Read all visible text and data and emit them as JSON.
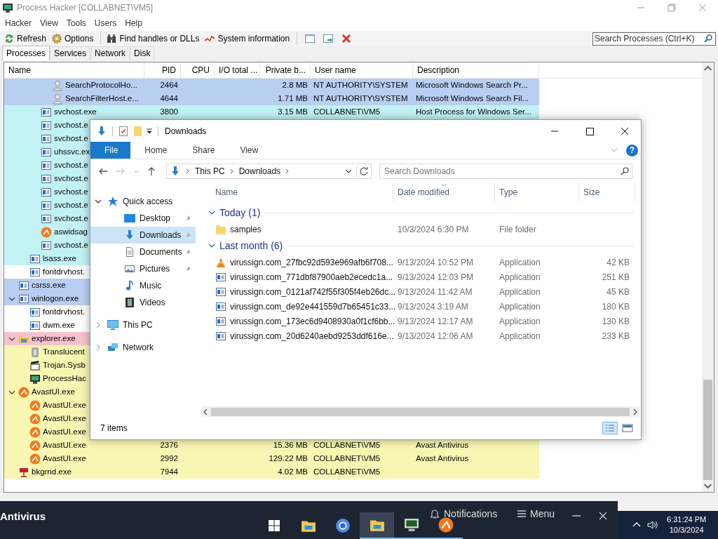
{
  "process_hacker": {
    "title": "Process Hacker [COLLABNET\\VM5]",
    "menu": [
      "Hacker",
      "View",
      "Tools",
      "Users",
      "Help"
    ],
    "toolbar": [
      {
        "label": "Refresh",
        "kind": "refresh"
      },
      {
        "label": "Options",
        "kind": "options"
      },
      {
        "label": "Find handles or DLLs",
        "kind": "find"
      },
      {
        "label": "System information",
        "kind": "sysinfo"
      }
    ],
    "search": {
      "placeholder": "Search Processes (Ctrl+K)"
    },
    "tabs": [
      {
        "label": "Processes",
        "selected": true
      },
      {
        "label": "Services",
        "selected": false
      },
      {
        "label": "Network",
        "selected": false
      },
      {
        "label": "Disk",
        "selected": false
      }
    ],
    "columns": [
      "Name",
      "PID",
      "CPU",
      "I/O total ...",
      "Private b...",
      "User name",
      "Description"
    ],
    "processes": [
      {
        "children": [
          {
            "children": [
              {
                "children": [
                  {
                    "name": "SearchProtocolHo...",
                    "pid": "2464",
                    "private": "2.8 MB",
                    "user": "NT AUTHORITY\\SYSTEM",
                    "description": "Microsoft Windows Search Pr...",
                    "kind": "person",
                    "color": "#b9cff2"
                  },
                  {
                    "name": "SearchFilterHost.e...",
                    "pid": "4644",
                    "private": "1.71 MB",
                    "user": "NT AUTHORITY\\SYSTEM",
                    "description": "Microsoft Windows Search Fil...",
                    "kind": "person",
                    "color": "#b9cff2"
                  }
                ]
              },
              {
                "name": "svchost.exe",
                "pid": "3800",
                "private": "3.15 MB",
                "user": "COLLABNET\\VM5",
                "description": "Host Process for Windows Ser...",
                "kind": "app",
                "color": "#c3f2f5"
              },
              {
                "name": "svchost.e",
                "kind": "app",
                "color": "#c3f2f5"
              },
              {
                "name": "svchost.e",
                "kind": "app",
                "color": "#c3f2f5"
              },
              {
                "name": "uhssvc.ex",
                "kind": "app",
                "color": "#c3f2f5"
              },
              {
                "name": "svchost.e",
                "kind": "app",
                "color": "#c3f2f5"
              },
              {
                "name": "svchost.e",
                "kind": "app",
                "color": "#c3f2f5"
              },
              {
                "name": "svchost.e",
                "kind": "app",
                "color": "#c3f2f5"
              },
              {
                "name": "svchost.e",
                "kind": "app",
                "color": "#c3f2f5"
              },
              {
                "name": "svchost.e",
                "kind": "app",
                "color": "#c3f2f5"
              },
              {
                "name": "aswidsag",
                "kind": "orange",
                "color": "#c3f2f5"
              },
              {
                "name": "svchost.e",
                "kind": "app",
                "color": "#c3f2f5"
              }
            ]
          },
          {
            "name": "lsass.exe",
            "kind": "app",
            "color": "#c3f2f5"
          },
          {
            "name": "fontdrvhost.",
            "kind": "app",
            "color": "#ffffff"
          }
        ]
      },
      {
        "name": "csrss.exe",
        "kind": "app",
        "color": "#b9cff2"
      },
      {
        "name": "winlogon.exe",
        "kind": "app",
        "color": "#b9cff2",
        "expanded": true,
        "children": [
          {
            "name": "fontdrvhost.",
            "kind": "app",
            "color": "#ffffff"
          },
          {
            "name": "dwm.exe",
            "kind": "app",
            "color": "#ffffff"
          }
        ]
      },
      {
        "name": "explorer.exe",
        "kind": "folder",
        "color": "#f6c3cd",
        "expanded": true,
        "children": [
          {
            "name": "Translucent",
            "kind": "gray",
            "color": "#f8f6b3"
          },
          {
            "name": "Trojan.Sysb",
            "kind": "clapper",
            "color": "#f8f6b3"
          },
          {
            "name": "ProcessHac",
            "kind": "monitor",
            "color": "#f8f6b3"
          }
        ]
      },
      {
        "name": "AvastUI.exe",
        "kind": "orange",
        "color": "#f8f6b3",
        "expanded": true,
        "children": [
          {
            "name": "AvastUI.exe",
            "kind": "orange",
            "color": "#f8f6b3"
          },
          {
            "name": "AvastUI.exe",
            "kind": "orange",
            "color": "#f8f6b3"
          },
          {
            "name": "AvastUI.exe",
            "kind": "orange",
            "color": "#f8f6b3"
          },
          {
            "name": "AvastUI.exe",
            "pid": "2376",
            "private": "15.36 MB",
            "user": "COLLABNET\\VM5",
            "description": "Avast Antivirus",
            "kind": "orange",
            "color": "#f8f6b3"
          },
          {
            "name": "AvastUI.exe",
            "pid": "2992",
            "private": "129.22 MB",
            "user": "COLLABNET\\VM5",
            "description": "Avast Antivirus",
            "kind": "orange",
            "color": "#f8f6b3"
          }
        ]
      },
      {
        "name": "bkgrnd.exe",
        "pid": "7944",
        "private": "4.02 MB",
        "user": "COLLABNET\\VM5",
        "kind": "red",
        "color": "#f8f6b3"
      }
    ]
  },
  "explorer": {
    "title": "Downloads",
    "ribbon_tabs": [
      {
        "label": "File",
        "selected": true
      },
      {
        "label": "Home",
        "selected": false
      },
      {
        "label": "Share",
        "selected": false
      },
      {
        "label": "View",
        "selected": false
      }
    ],
    "help": "?",
    "path": [
      "This PC",
      "Downloads"
    ],
    "search": {
      "placeholder": "Search Downloads"
    },
    "nav": [
      {
        "label": "Quick access",
        "kind": "star",
        "expanded": true,
        "selected": false,
        "children": [
          {
            "label": "Desktop",
            "kind": "desktop",
            "pinned": true,
            "selected": false
          },
          {
            "label": "Downloads",
            "kind": "download",
            "pinned": true,
            "selected": true
          },
          {
            "label": "Documents",
            "kind": "document",
            "pinned": true,
            "selected": false
          },
          {
            "label": "Pictures",
            "kind": "picture",
            "pinned": true,
            "selected": false
          },
          {
            "label": "Music",
            "kind": "music",
            "pinned": false,
            "selected": false
          },
          {
            "label": "Videos",
            "kind": "video",
            "pinned": false,
            "selected": false
          }
        ]
      },
      {
        "label": "This PC",
        "kind": "pc",
        "expanded": false,
        "selected": false
      },
      {
        "label": "Network",
        "kind": "network",
        "expanded": false,
        "selected": false
      }
    ],
    "columns": [
      "Name",
      "Date modified",
      "Type",
      "Size"
    ],
    "groups": [
      {
        "title": "Today (1)",
        "expanded": true,
        "files": [
          {
            "name": "samples",
            "date": "10/3/2024 6:30 PM",
            "type": "File folder",
            "kind": "folder"
          }
        ]
      },
      {
        "title": "Last month (6)",
        "expanded": true,
        "files": [
          {
            "name": "virussign.com_27fbc92d593e969afb6f708...",
            "date": "9/13/2024 10:52 PM",
            "type": "Application",
            "size": "42 KB",
            "kind": "cone"
          },
          {
            "name": "virussign.com_771dbf87900aeb2ecedc1a...",
            "date": "9/13/2024 12:03 PM",
            "type": "Application",
            "size": "251 KB",
            "kind": "app"
          },
          {
            "name": "virussign.com_0121af742f55f305f4eb26dc...",
            "date": "9/13/2024 11:42 AM",
            "type": "Application",
            "size": "45 KB",
            "kind": "app"
          },
          {
            "name": "virussign.com_de92e441559d7b65451c33...",
            "date": "9/13/2024 3:19 AM",
            "type": "Application",
            "size": "180 KB",
            "kind": "app"
          },
          {
            "name": "virussign.com_173ec6d9408930a0f1cf6bb...",
            "date": "9/13/2024 12:17 AM",
            "type": "Application",
            "size": "130 KB",
            "kind": "app"
          },
          {
            "name": "virussign.com_20d6240aebd9253ddf616e...",
            "date": "9/13/2024 12:06 AM",
            "type": "Application",
            "size": "233 KB",
            "kind": "app"
          }
        ]
      }
    ],
    "status": "7 items",
    "views": [
      {
        "kind": "details",
        "selected": true
      },
      {
        "kind": "tiles",
        "selected": false
      }
    ]
  },
  "taskbar": {
    "notification_title": "Antivirus",
    "notifications": "Notifications",
    "menu": "Menu",
    "apps": [
      {
        "kind": "start",
        "running": false,
        "active": false
      },
      {
        "kind": "folder",
        "running": false,
        "active": false
      },
      {
        "kind": "browser",
        "running": false,
        "active": false
      },
      {
        "kind": "folder",
        "running": true,
        "active": true
      },
      {
        "kind": "monitor",
        "running": true,
        "active": false
      },
      {
        "kind": "orange",
        "running": true,
        "active": false
      }
    ],
    "time": "6:31:24 PM",
    "date": "10/3/2024"
  }
}
